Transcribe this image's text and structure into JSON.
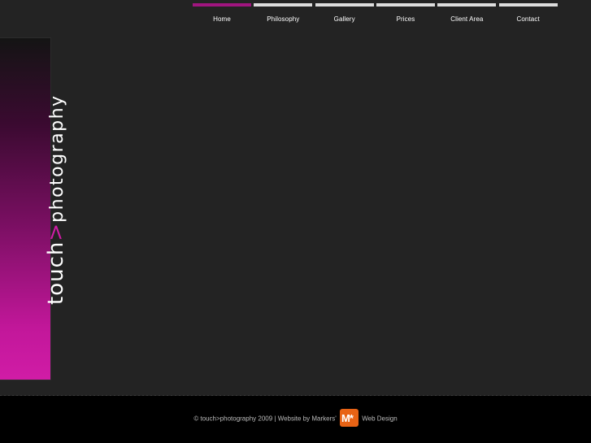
{
  "nav": {
    "items": [
      {
        "label": "Home",
        "active": true
      },
      {
        "label": "Philosophy"
      },
      {
        "label": "Gallery"
      },
      {
        "label": "Prices"
      },
      {
        "label": "Client Area"
      },
      {
        "label": "Contact"
      }
    ]
  },
  "logo": {
    "part1": "touch",
    "chevron": ">",
    "part2": "photography"
  },
  "footer": {
    "copyright": "© touch>photography 2009 | Website by Markers'",
    "badge_text": "M*",
    "suffix": "Web Design"
  },
  "colors": {
    "accent": "#a0157f",
    "background": "#232323",
    "footer_bg": "#000000",
    "nav_bar": "#dddddd",
    "logo_badge": "#e86315"
  }
}
